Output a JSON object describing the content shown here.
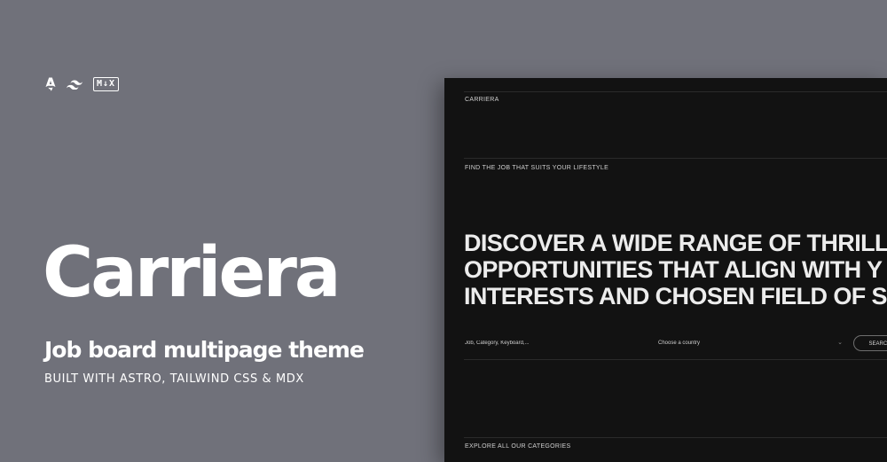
{
  "tech_logos": [
    {
      "name": "astro-logo"
    },
    {
      "name": "tailwind-logo"
    },
    {
      "name": "mdx-logo",
      "text": "M↓X"
    }
  ],
  "brand": {
    "title": "Carriera",
    "subtitle": "Job board multipage theme",
    "tagline": "BUILT WITH ASTRO, TAILWIND CSS & MDX"
  },
  "preview": {
    "site_name": "CARRIERA",
    "section_label": "FIND THE JOB THAT SUITS YOUR LIFESTYLE",
    "headline": [
      "DISCOVER A WIDE RANGE OF THRILL",
      "OPPORTUNITIES THAT ALIGN WITH Y",
      "INTERESTS AND CHOSEN FIELD OF S"
    ],
    "search": {
      "placeholder": "Job, Category, Keyboard,...",
      "country_placeholder": "Choose a country",
      "button_label": "SEARCH"
    },
    "categories_label": "EXPLORE ALL OUR CATEGORIES"
  },
  "colors": {
    "background": "#70717a",
    "preview_bg": "#121212",
    "text_light": "#ffffff"
  }
}
